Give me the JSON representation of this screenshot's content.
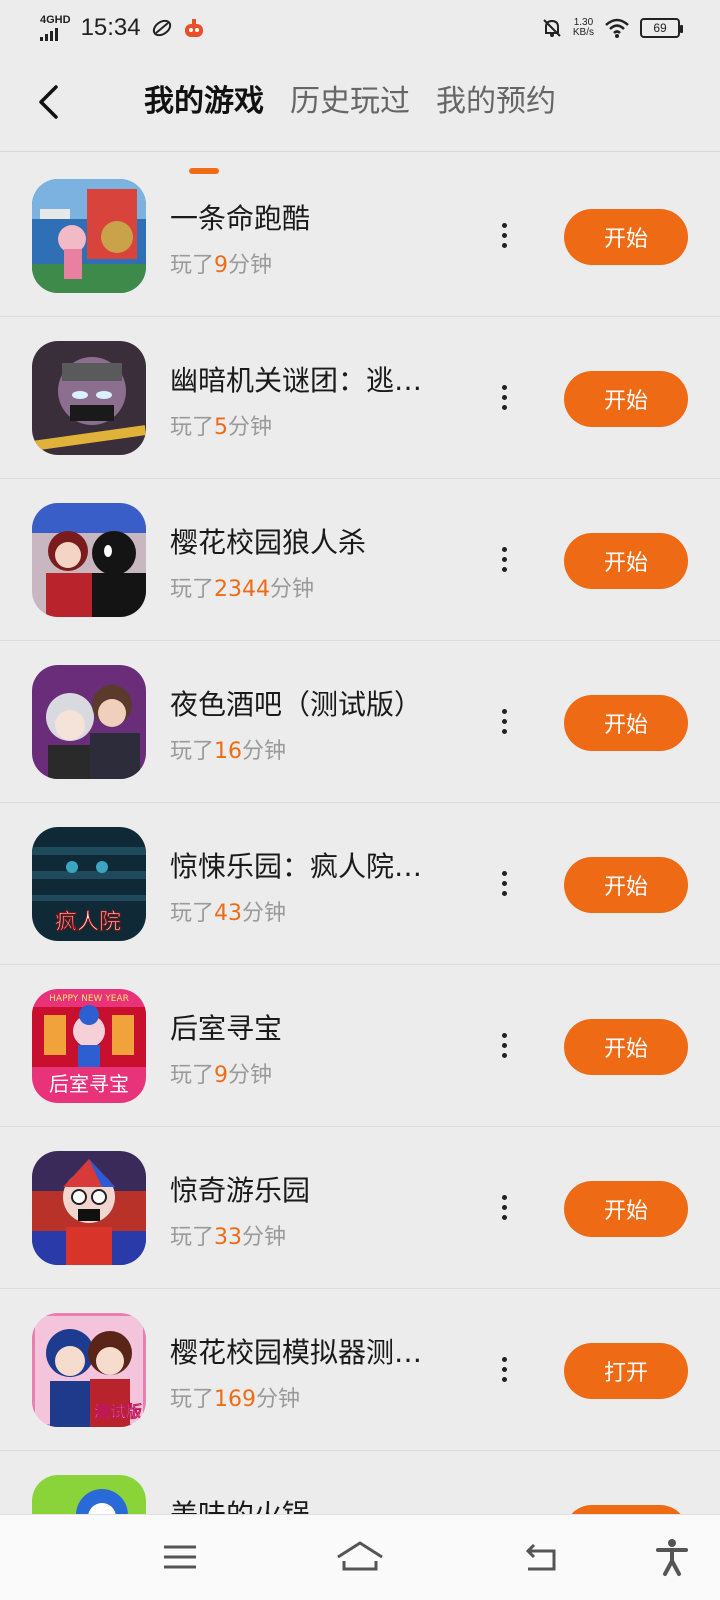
{
  "status_bar": {
    "network": "4GHD",
    "time": "15:34",
    "speed_value": "1.30",
    "speed_unit": "KB/s",
    "battery": "69"
  },
  "header": {
    "tabs": [
      {
        "label": "我的游戏",
        "active": true
      },
      {
        "label": "历史玩过",
        "active": false
      },
      {
        "label": "我的预约",
        "active": false
      }
    ]
  },
  "accent_color": "#ee6a14",
  "games": [
    {
      "title": "一条命跑酷",
      "prefix": "玩了",
      "minutes": "9",
      "suffix": "分钟",
      "button": "开始"
    },
    {
      "title": "幽暗机关谜团：逃…",
      "prefix": "玩了",
      "minutes": "5",
      "suffix": "分钟",
      "button": "开始"
    },
    {
      "title": "樱花校园狼人杀",
      "prefix": "玩了",
      "minutes": "2344",
      "suffix": "分钟",
      "button": "开始"
    },
    {
      "title": "夜色酒吧（测试版）",
      "prefix": "玩了",
      "minutes": "16",
      "suffix": "分钟",
      "button": "开始"
    },
    {
      "title": "惊悚乐园：疯人院…",
      "prefix": "玩了",
      "minutes": "43",
      "suffix": "分钟",
      "button": "开始"
    },
    {
      "title": "后室寻宝",
      "prefix": "玩了",
      "minutes": "9",
      "suffix": "分钟",
      "button": "开始"
    },
    {
      "title": "惊奇游乐园",
      "prefix": "玩了",
      "minutes": "33",
      "suffix": "分钟",
      "button": "开始"
    },
    {
      "title": "樱花校园模拟器测…",
      "prefix": "玩了",
      "minutes": "169",
      "suffix": "分钟",
      "button": "打开"
    },
    {
      "title": "美味的火锅",
      "prefix": "",
      "minutes": "",
      "suffix": "",
      "button": ""
    }
  ],
  "icon_texts": {
    "asylum": "疯人院",
    "happy_new_year": "HAPPY NEW YEAR",
    "backrooms": "后室寻宝",
    "beta": "测试版"
  }
}
